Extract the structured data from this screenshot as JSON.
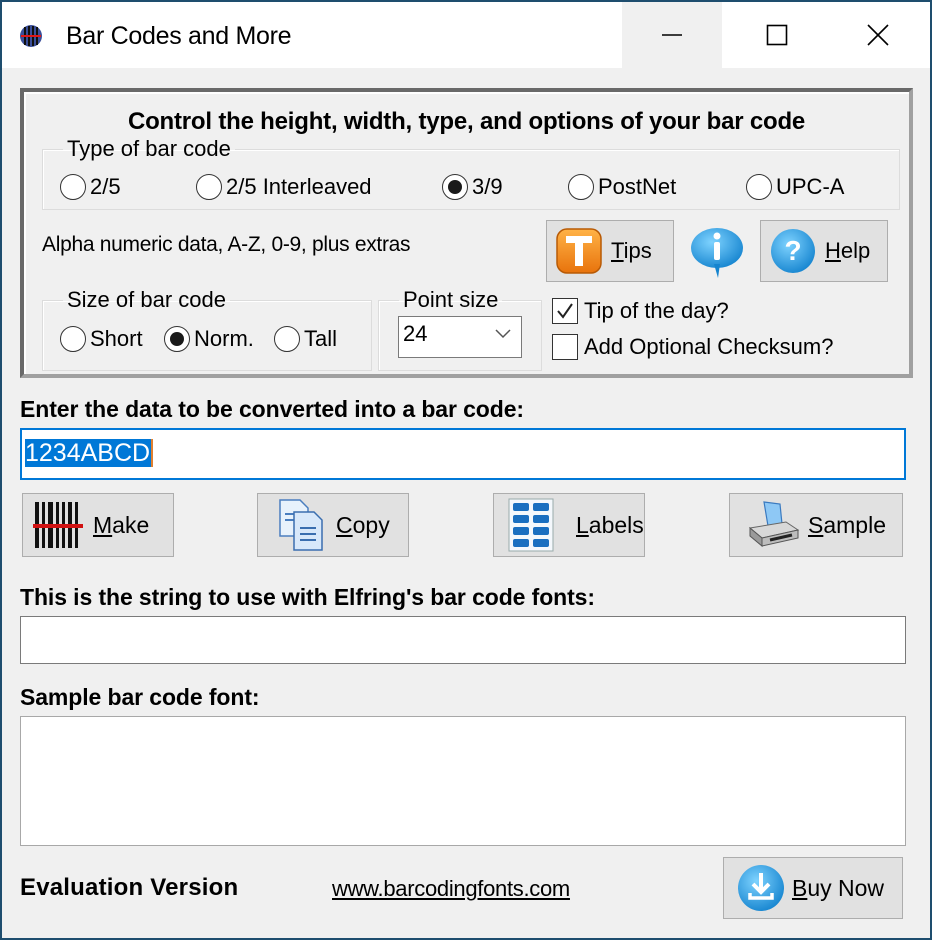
{
  "window": {
    "title": "Bar Codes and More",
    "controls": {
      "minimize": "—",
      "maximize": "☐",
      "close": "✕"
    }
  },
  "options": {
    "heading": "Control the height, width, type, and options of your bar code",
    "type_group": {
      "legend": "Type of bar code",
      "options": [
        {
          "label": "2/5",
          "selected": false
        },
        {
          "label": "2/5 Interleaved",
          "selected": false
        },
        {
          "label": "3/9",
          "selected": true
        },
        {
          "label": "PostNet",
          "selected": false
        },
        {
          "label": "UPC-A",
          "selected": false
        }
      ]
    },
    "description": "Alpha numeric data, A-Z, 0-9, plus extras",
    "tips_button": {
      "mnemonic": "T",
      "rest": "ips",
      "icon": "tips-t-icon"
    },
    "info_icon": "info-bubble-icon",
    "help_button": {
      "mnemonic": "H",
      "rest": "elp",
      "icon": "help-question-icon"
    },
    "size_group": {
      "legend": "Size of bar code",
      "options": [
        {
          "label": "Short",
          "selected": false
        },
        {
          "label": "Norm.",
          "selected": true
        },
        {
          "label": "Tall",
          "selected": false
        }
      ]
    },
    "point_size": {
      "legend": "Point size",
      "value": "24"
    },
    "checkboxes": [
      {
        "label": "Tip of the day?",
        "checked": true
      },
      {
        "label": "Add Optional Checksum?",
        "checked": false
      }
    ]
  },
  "input_section": {
    "label": "Enter the data to be converted into a bar code:",
    "value": "1234ABCD"
  },
  "actions": [
    {
      "mnemonic": "M",
      "rest": "ake",
      "icon": "barcode-icon"
    },
    {
      "mnemonic": "C",
      "rest": "opy",
      "icon": "copy-icon"
    },
    {
      "mnemonic": "L",
      "rest": "abels",
      "icon": "labels-icon"
    },
    {
      "mnemonic": "S",
      "rest": "ample",
      "icon": "printer-icon"
    }
  ],
  "output_section": {
    "label": "This is the string to use with Elfring's bar code fonts:",
    "value": ""
  },
  "sample_section": {
    "label": "Sample bar code font:"
  },
  "footer": {
    "evaluation": "Evaluation Version",
    "link": "www.barcodingfonts.com",
    "buy_button": {
      "mnemonic": "B",
      "rest": "uy Now",
      "icon": "download-icon"
    }
  },
  "colors": {
    "accent": "#0078d7",
    "tips_orange": "#f08a1c",
    "info_blue": "#2a9ee0",
    "window_frame": "#1e4d6e"
  }
}
